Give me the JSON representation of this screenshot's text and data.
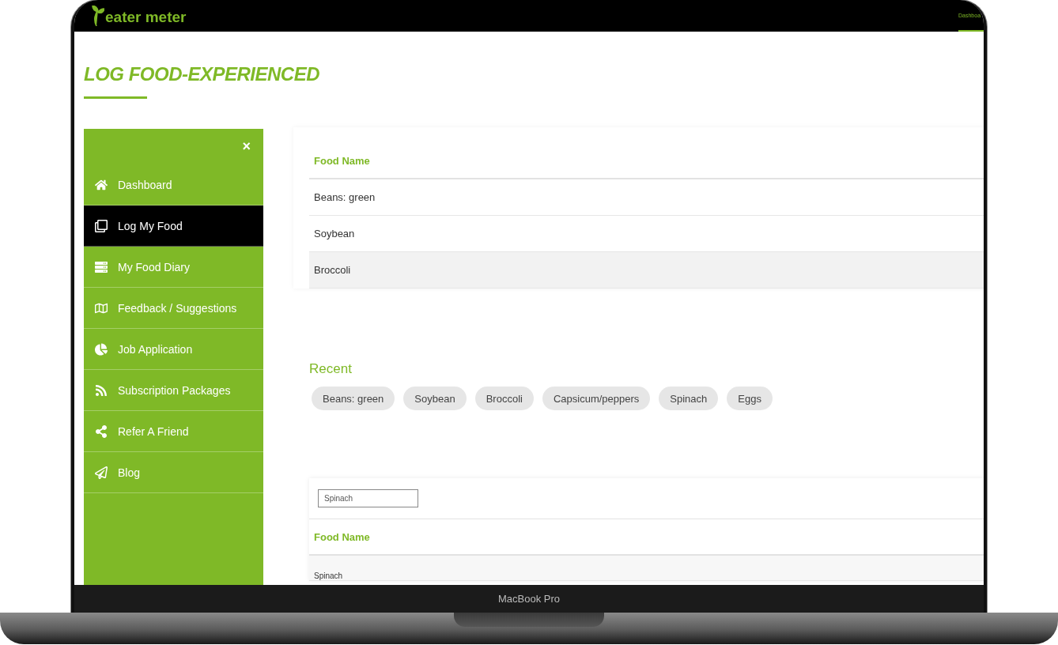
{
  "nav": {
    "logo": "eater meter",
    "links": [
      {
        "label": "Dashboa",
        "selected": true
      }
    ]
  },
  "page": {
    "title": "LOG FOOD-EXPERIENCED"
  },
  "sidebar": {
    "close": "×",
    "items": [
      {
        "label": "Dashboard",
        "selected": false
      },
      {
        "label": "Log My Food",
        "selected": true
      },
      {
        "label": "My Food Diary",
        "selected": false
      },
      {
        "label": "Feedback / Suggestions",
        "selected": false
      },
      {
        "label": "Job Application",
        "selected": false
      },
      {
        "label": "Subscription Packages",
        "selected": false
      },
      {
        "label": "Refer A Friend",
        "selected": false
      },
      {
        "label": "Blog",
        "selected": false
      }
    ]
  },
  "food_table": {
    "columns": [
      "Food Name"
    ],
    "rows": [
      {
        "name": "Beans: green",
        "selected": false
      },
      {
        "name": "Soybean",
        "selected": false
      },
      {
        "name": "Broccoli",
        "selected": true
      }
    ]
  },
  "recent": {
    "title": "Recent",
    "chips": [
      "Beans: green",
      "Soybean",
      "Broccoli",
      "Capsicum/peppers",
      "Spinach",
      "Eggs"
    ]
  },
  "search_table": {
    "search": {
      "value": "Spinach"
    },
    "columns": [
      "Food Name"
    ],
    "rows": [
      {
        "name": "Spinach"
      }
    ]
  },
  "device": {
    "label": "MacBook Pro"
  }
}
